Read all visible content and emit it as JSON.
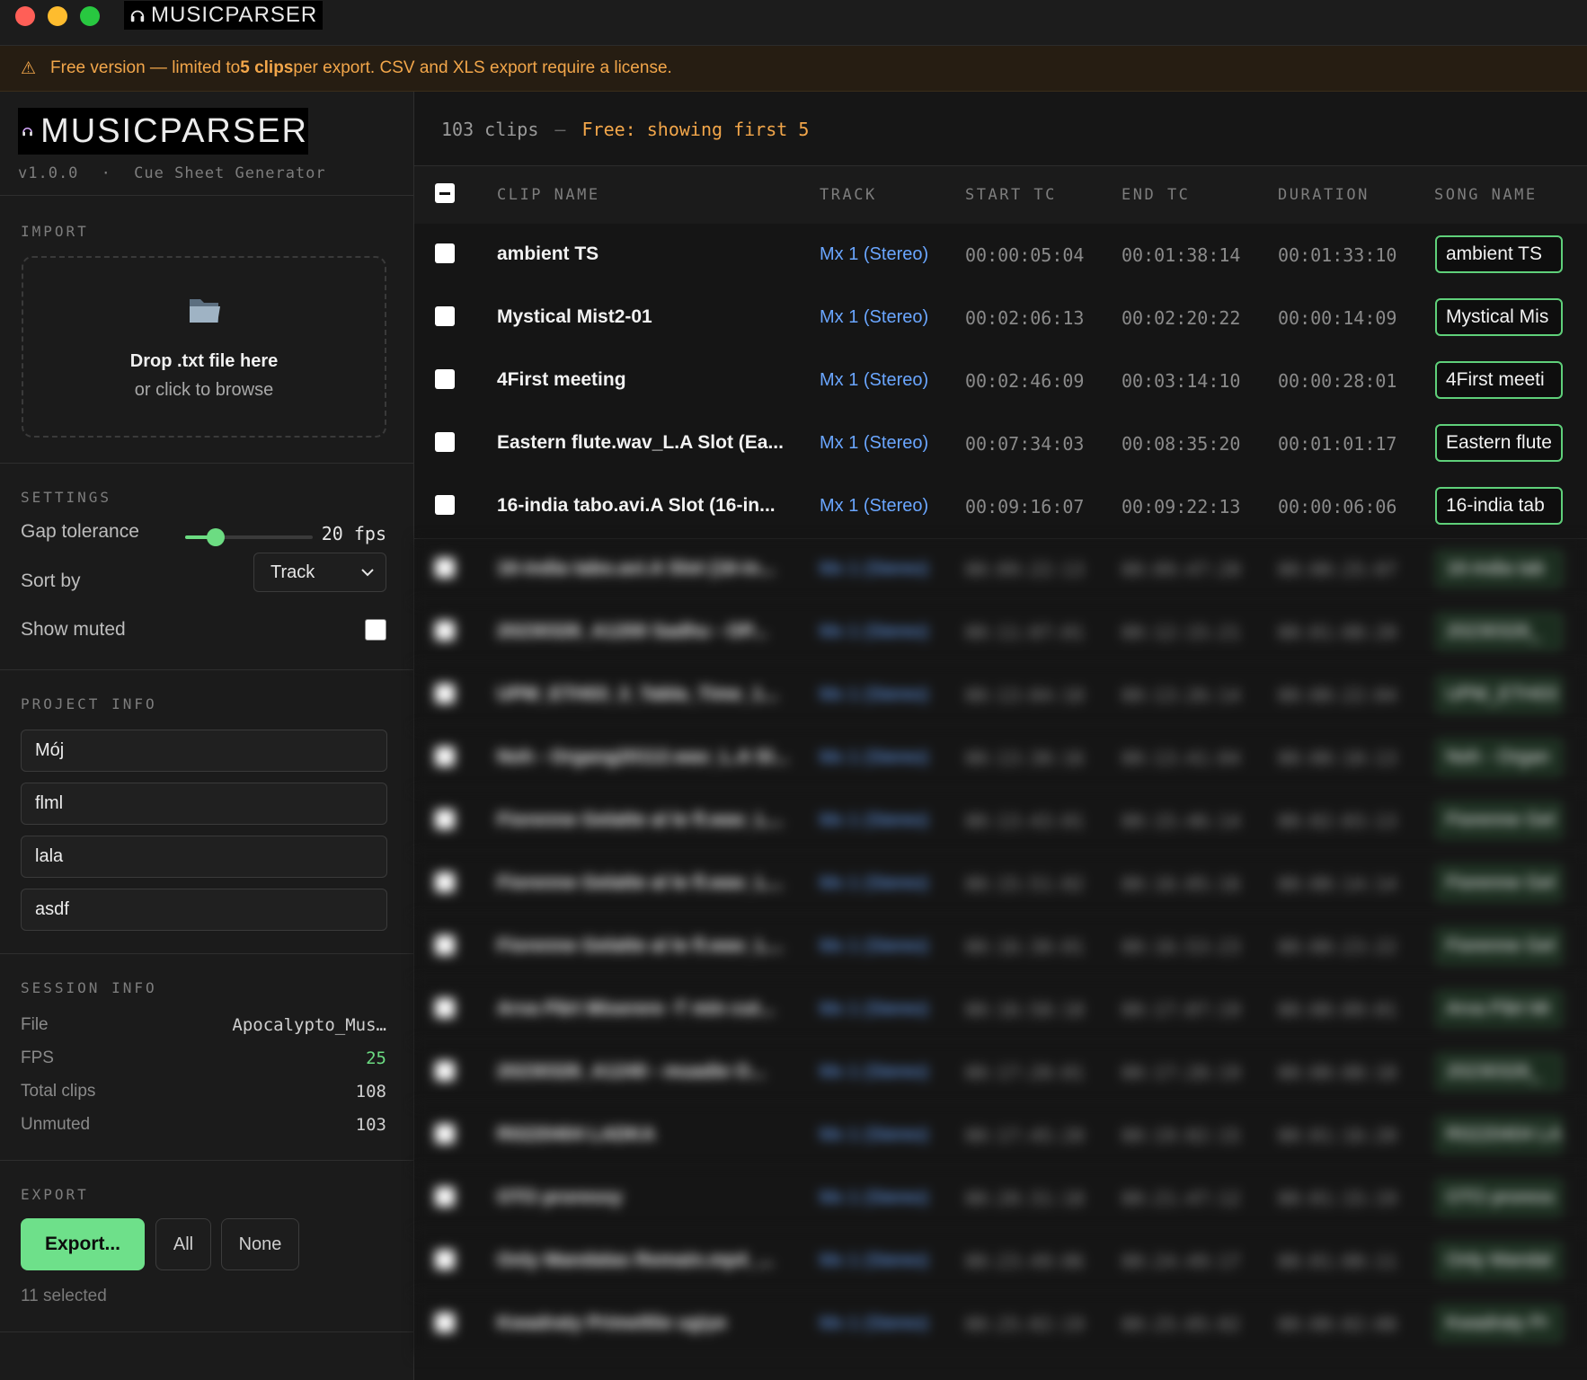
{
  "titlebar": {
    "app_name": "MUSICPARSER"
  },
  "banner": {
    "text_before": "Free version — limited to ",
    "bold": "5 clips",
    "text_after": " per export. CSV and XLS export require a license."
  },
  "sidebar": {
    "brand": "MUSICPARSER",
    "version": "v1.0.0",
    "separator": "·",
    "subtitle": "Cue Sheet Generator",
    "import": {
      "title": "IMPORT",
      "drop_title": "Drop .txt file here",
      "drop_sub": "or click to browse"
    },
    "settings": {
      "title": "SETTINGS",
      "gap_label": "Gap tolerance",
      "gap_value": "20",
      "gap_unit": "fps",
      "gap_fraction": 0.24,
      "sort_label": "Sort by",
      "sort_value": "Track",
      "muted_label": "Show muted"
    },
    "project_info": {
      "title": "PROJECT INFO",
      "fields": [
        "Mój",
        "flml",
        "lala",
        "asdf"
      ]
    },
    "session_info": {
      "title": "SESSION INFO",
      "file_label": "File",
      "file_value": "Apocalypto_Mus…",
      "fps_label": "FPS",
      "fps_value": "25",
      "total_label": "Total clips",
      "total_value": "108",
      "unmuted_label": "Unmuted",
      "unmuted_value": "103"
    },
    "export": {
      "title": "EXPORT",
      "export_btn": "Export...",
      "all_btn": "All",
      "none_btn": "None",
      "selected": "11 selected"
    }
  },
  "main": {
    "clip_count": "103 clips",
    "dash": "—",
    "free_note": "Free: showing first 5",
    "columns": [
      "CLIP NAME",
      "TRACK",
      "START TC",
      "END TC",
      "DURATION",
      "SONG NAME"
    ],
    "rows": [
      {
        "name": "ambient TS",
        "track": "Mx 1 (Stereo)",
        "start": "00:00:05:04",
        "end": "00:01:38:14",
        "duration": "00:01:33:10",
        "song": "ambient TS"
      },
      {
        "name": "Mystical Mist2-01",
        "track": "Mx 1 (Stereo)",
        "start": "00:02:06:13",
        "end": "00:02:20:22",
        "duration": "00:00:14:09",
        "song": "Mystical Mis"
      },
      {
        "name": "4First meeting",
        "track": "Mx 1 (Stereo)",
        "start": "00:02:46:09",
        "end": "00:03:14:10",
        "duration": "00:00:28:01",
        "song": "4First meeti"
      },
      {
        "name": "Eastern flute.wav_L.A Slot (Ea...",
        "track": "Mx 1 (Stereo)",
        "start": "00:07:34:03",
        "end": "00:08:35:20",
        "duration": "00:01:01:17",
        "song": "Eastern flute"
      },
      {
        "name": "16-india tabo.avi.A Slot (16-in...",
        "track": "Mx 1 (Stereo)",
        "start": "00:09:16:07",
        "end": "00:09:22:13",
        "duration": "00:00:06:06",
        "song": "16-india tab"
      }
    ],
    "blurred_rows": [
      {
        "name": "16-india tabo.avi.A Slot (16-in...",
        "track": "Mx 1 (Stereo)",
        "start": "00:09:22:13",
        "end": "00:09:47:20",
        "duration": "00:00:25:07",
        "song": "16-india tab"
      },
      {
        "name": "20230326_A1200 Sadhu - OP...",
        "track": "Mx 1 (Stereo)",
        "start": "00:11:07:01",
        "end": "00:12:15:21",
        "duration": "00:01:08:20",
        "song": "20230326_"
      },
      {
        "name": "UPM_ETH03_3_Tabla_Time_1...",
        "track": "Mx 1 (Stereo)",
        "start": "00:13:04:10",
        "end": "00:13:26:14",
        "duration": "00:00:22:04",
        "song": "UPM_ETH03"
      },
      {
        "name": "Noh - Organg20112.wav_L.A Sl...",
        "track": "Mx 1 (Stereo)",
        "start": "00:13:30:16",
        "end": "00:13:41:04",
        "duration": "00:00:10:13",
        "song": "Noh - Organ"
      },
      {
        "name": "Fiorenne Gelatte al le fl.wav_L...",
        "track": "Mx 1 (Stereo)",
        "start": "00:13:43:01",
        "end": "00:15:46:14",
        "duration": "00:02:03:13",
        "song": "Fiorenne Gel"
      },
      {
        "name": "Fiorenne Gelatte al le fl.wav_L...",
        "track": "Mx 1 (Stereo)",
        "start": "00:15:51:02",
        "end": "00:16:05:16",
        "duration": "00:00:14:14",
        "song": "Fiorenne Gel"
      },
      {
        "name": "Fiorenne Gelatte al le fl.wav_L...",
        "track": "Mx 1 (Stereo)",
        "start": "00:16:30:01",
        "end": "00:16:53:23",
        "duration": "00:00:23:22",
        "song": "Fiorenne Gel"
      },
      {
        "name": "Arva Pãrt Miserere -T mín cut...",
        "track": "Mx 1 (Stereo)",
        "start": "00:16:58:18",
        "end": "00:17:07:19",
        "duration": "00:00:09:01",
        "song": "Arva Pãrt Mi"
      },
      {
        "name": "20230326_A1240 - muadie O...",
        "track": "Mx 1 (Stereo)",
        "start": "00:17:20:01",
        "end": "00:17:28:19",
        "duration": "00:00:08:18",
        "song": "20230326_"
      },
      {
        "name": "R0220404 LADKA",
        "track": "Mx 1 (Stereo)",
        "start": "00:17:45:20",
        "end": "00:19:02:15",
        "duration": "00:01:16:20",
        "song": "R0220404 LA"
      },
      {
        "name": "OTO proressy",
        "track": "Mx 1 (Stereo)",
        "start": "00:20:31:18",
        "end": "00:21:47:12",
        "duration": "00:01:15:19",
        "song": "OTO proress"
      },
      {
        "name": "Only Mandalas Remain.mp4_...",
        "track": "Mx 1 (Stereo)",
        "start": "00:23:49:06",
        "end": "00:24:49:17",
        "duration": "00:01:00:11",
        "song": "Only Mandal"
      },
      {
        "name": "Kwadraty Primeltlie ugiye",
        "track": "Mx 1 (Stereo)",
        "start": "00:25:02:19",
        "end": "00:25:05:02",
        "duration": "00:00:02:08",
        "song": "Kwadraty Pr"
      }
    ]
  }
}
